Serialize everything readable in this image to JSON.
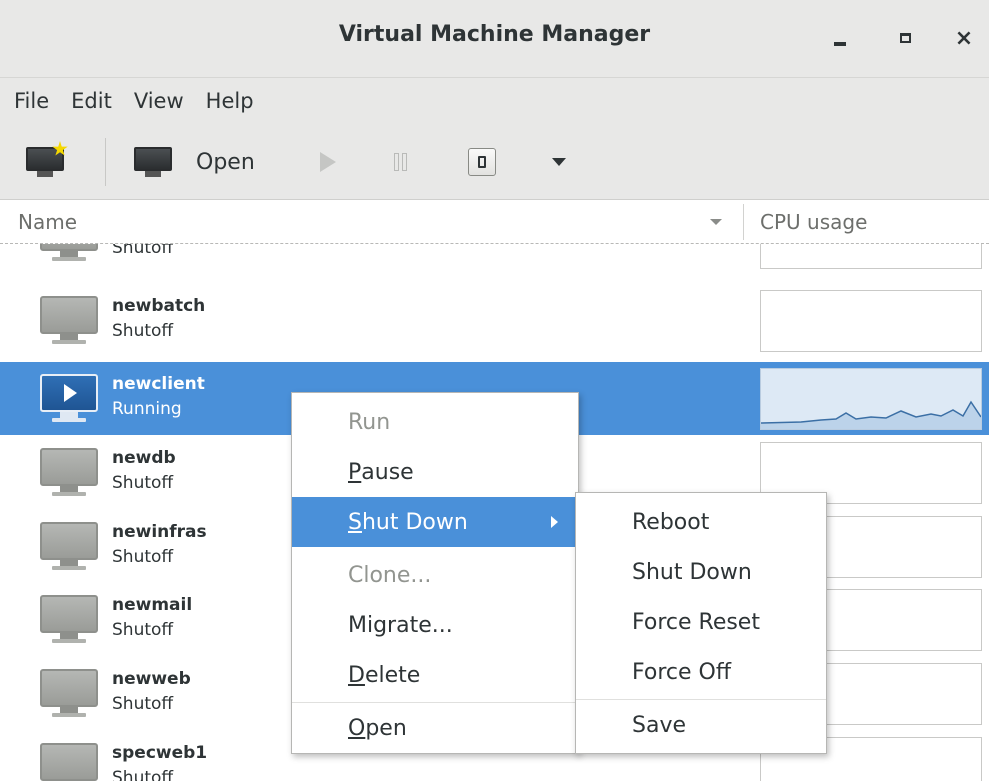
{
  "window": {
    "title": "Virtual Machine Manager",
    "minimize_label": "_",
    "close_label": "×"
  },
  "menubar": {
    "items": [
      "File",
      "Edit",
      "View",
      "Help"
    ]
  },
  "toolbar": {
    "new_icon": "new-vm-icon",
    "open_label": "Open"
  },
  "columns": {
    "name": "Name",
    "cpu": "CPU usage"
  },
  "vms": [
    {
      "name": "",
      "status": "Shutoff"
    },
    {
      "name": "newbatch",
      "status": "Shutoff"
    },
    {
      "name": "newclient",
      "status": "Running",
      "selected": true
    },
    {
      "name": "newdb",
      "status": "Shutoff"
    },
    {
      "name": "newinfras",
      "status": "Shutoff"
    },
    {
      "name": "newmail",
      "status": "Shutoff"
    },
    {
      "name": "newweb",
      "status": "Shutoff"
    },
    {
      "name": "specweb1",
      "status": "Shutoff"
    }
  ],
  "context_menu": {
    "run": "Run",
    "pause": {
      "accel": "P",
      "rest": "ause"
    },
    "shut_down": {
      "accel": "S",
      "rest": "hut Down"
    },
    "clone": "Clone...",
    "migrate": "Migrate...",
    "delete": {
      "accel": "D",
      "rest": "elete"
    },
    "open": {
      "accel": "O",
      "rest": "pen"
    }
  },
  "submenu": {
    "reboot": "Reboot",
    "shut_down": "Shut Down",
    "force_reset": "Force Reset",
    "force_off": "Force Off",
    "save": "Save"
  },
  "colors": {
    "selection": "#4a90d9",
    "chrome": "#e8e8e7"
  }
}
